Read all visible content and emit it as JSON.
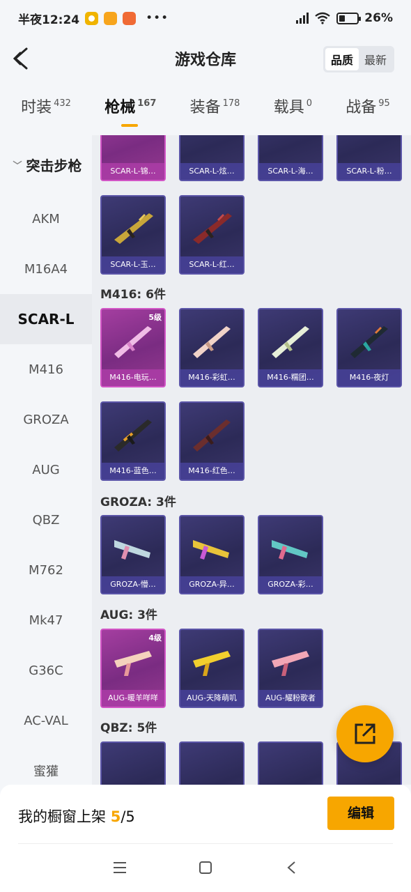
{
  "status_bar": {
    "time": "半夜12:24",
    "battery": "26%"
  },
  "header": {
    "title": "游戏仓库",
    "sort_options": [
      "品质",
      "最新"
    ]
  },
  "tabs": [
    {
      "label": "时装",
      "count": "432"
    },
    {
      "label": "枪械",
      "count": "167"
    },
    {
      "label": "装备",
      "count": "178"
    },
    {
      "label": "载具",
      "count": "0"
    },
    {
      "label": "战备",
      "count": "95"
    }
  ],
  "sidebar": {
    "category": "突击步枪",
    "items": [
      "AKM",
      "M16A4",
      "SCAR-L",
      "M416",
      "GROZA",
      "AUG",
      "QBZ",
      "M762",
      "Mk47",
      "G36C",
      "AC-VAL",
      "蜜獾"
    ]
  },
  "sections": {
    "scar_top": [
      "SCAR-L-锦…",
      "SCAR-L-炫…",
      "SCAR-L-海…",
      "SCAR-L-粉…"
    ],
    "scar_row2": [
      "SCAR-L-玉…",
      "SCAR-L-红…"
    ],
    "m416": {
      "header": "M416: 6件",
      "level": "5级",
      "items": [
        "M416-电玩…",
        "M416-彩虹…",
        "M416-糯团…",
        "M416-夜灯",
        "M416-蓝色…",
        "M416-红色…"
      ]
    },
    "groza": {
      "header": "GROZA: 3件",
      "items": [
        "GROZA-懵…",
        "GROZA-异…",
        "GROZA-彩…"
      ]
    },
    "aug": {
      "header": "AUG: 3件",
      "level": "4级",
      "items": [
        "AUG-暖羊咩咩",
        "AUG-天降萌叽",
        "AUG-耀粉歌者"
      ]
    },
    "qbz": {
      "header": "QBZ: 5件"
    }
  },
  "bottom_bar": {
    "showcase_label": "我的橱窗上架",
    "showcase_current": "5",
    "showcase_total": "/5",
    "edit_label": "编辑"
  },
  "colors": {
    "accent": "#f7a600",
    "card_blue": "#3e3a75",
    "card_pink": "#a43ea0"
  },
  "icons": [
    "back-icon",
    "share-icon",
    "menu-icon",
    "home-icon",
    "back-nav-icon"
  ]
}
